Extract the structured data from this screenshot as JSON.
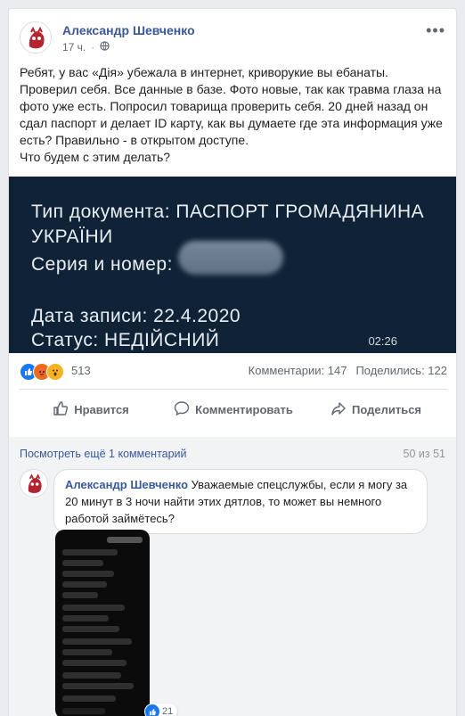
{
  "post": {
    "author": "Александр Шевченко",
    "time": "17 ч.",
    "privacy_icon": "globe-icon",
    "text": [
      "Ребят, у вас «Дія» убежала в интернет, криворукие вы ебанаты.",
      "Проверил себя. Все данные в базе. Фото новые, так как травма глаза на фото уже есть. Попросил товарища проверить себя. 20 дней назад он сдал паспорт и делает ID карту, как вы думаете где эта информация уже есть? Правильно - в открытом доступе.",
      "Что будем с этим делать?"
    ]
  },
  "video": {
    "line1": "Тип документа: ПАСПОРТ ГРОМАДЯНИНА",
    "line2": "УКРАЇНИ",
    "line3": "Серия и номер:",
    "line4": "Дата записи: 22.4.2020",
    "line5": "Статус: НЕДІЙСНИЙ",
    "duration": "02:26"
  },
  "stats": {
    "reactions_count": "513",
    "comments": "Комментарии: 147",
    "shares": "Поделились: 122"
  },
  "actions": {
    "like": "Нравится",
    "comment": "Комментировать",
    "share": "Поделиться"
  },
  "comments": {
    "view_more": "Посмотреть ещё 1 комментарий",
    "count": "50 из 51",
    "item": {
      "author": "Александр Шевченко",
      "text": "Уважаемые спецслужбы, если я могу за 20 минут в 3 ночи найти этих дятлов, то может вы немного работой займётесь?",
      "likes": "21"
    }
  },
  "colors": {
    "link": "#385898",
    "video_bg": "#102336",
    "like_blue": "#1877f2"
  }
}
